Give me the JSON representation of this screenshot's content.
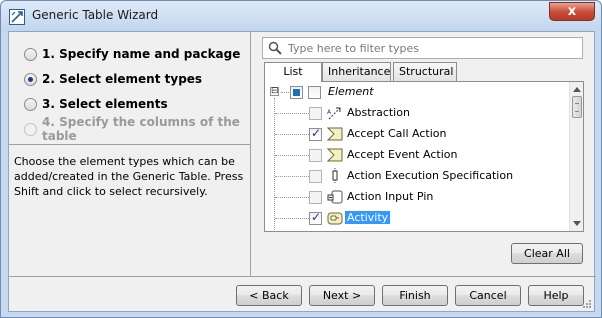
{
  "window": {
    "title": "Generic Table Wizard",
    "close_label": "x",
    "app_icon": "wizard-app-icon"
  },
  "steps": [
    {
      "label": "1. Specify name and package",
      "state": "unchecked"
    },
    {
      "label": "2. Select element types",
      "state": "checked"
    },
    {
      "label": "3. Select elements",
      "state": "unchecked"
    },
    {
      "label": "4. Specify the columns of the table",
      "state": "disabled"
    }
  ],
  "description": "Choose the element types which can be added/created in the Generic Table. Press Shift and click to select recursively.",
  "filter": {
    "placeholder": "Type here to filter types",
    "value": "",
    "icon": "search-icon"
  },
  "tabs": [
    {
      "label": "List",
      "active": true
    },
    {
      "label": "Inheritance",
      "active": false
    },
    {
      "label": "Structural",
      "active": false
    }
  ],
  "tree": {
    "root": {
      "label": "Element",
      "expander": "⊟",
      "checkbox": "partial"
    },
    "items": [
      {
        "label": "Abstraction",
        "checked": false,
        "icon": "abstraction-icon"
      },
      {
        "label": "Accept Call Action",
        "checked": true,
        "icon": "accept-call-action-icon"
      },
      {
        "label": "Accept Event Action",
        "checked": false,
        "icon": "accept-event-action-icon"
      },
      {
        "label": "Action Execution Specification",
        "checked": false,
        "icon": "action-execution-specification-icon"
      },
      {
        "label": "Action Input Pin",
        "checked": false,
        "icon": "action-input-pin-icon"
      },
      {
        "label": "Activity",
        "checked": true,
        "icon": "activity-icon",
        "selected": true
      }
    ]
  },
  "buttons": {
    "clear_all": "Clear All",
    "back": "< Back",
    "next": "Next >",
    "finish": "Finish",
    "cancel": "Cancel",
    "help": "Help"
  },
  "colors": {
    "selection": "#3399ff",
    "window_frame": "#c7d9ef",
    "close_button": "#c74a34"
  }
}
